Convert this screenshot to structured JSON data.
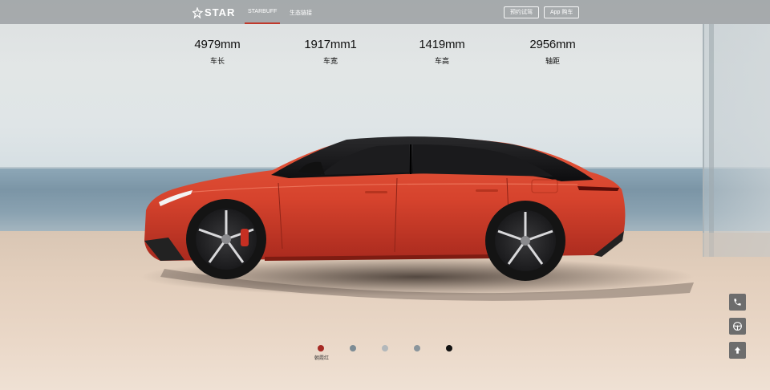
{
  "brand": {
    "logo_text": "STAR"
  },
  "nav": {
    "items": [
      {
        "label": "STARBUFF",
        "active": true
      },
      {
        "label": "生态链接",
        "active": false
      }
    ]
  },
  "actions": {
    "test_drive": "预约试驾",
    "app_buy": "App 购车"
  },
  "specs": [
    {
      "value": "4979mm",
      "label": "车长"
    },
    {
      "value": "1917mm1",
      "label": "车宽"
    },
    {
      "value": "1419mm",
      "label": "车高"
    },
    {
      "value": "2956mm",
      "label": "轴距"
    }
  ],
  "colors": {
    "selected_label": "朝霞红",
    "swatches": [
      "#a62a24",
      "#7d8c95",
      "#b3b8bb",
      "#8a959c",
      "#111111"
    ],
    "accent": "#c0392b",
    "car_body": "#d9452f"
  },
  "side_buttons": [
    "phone-icon",
    "steering-wheel-icon",
    "arrow-up-icon"
  ]
}
